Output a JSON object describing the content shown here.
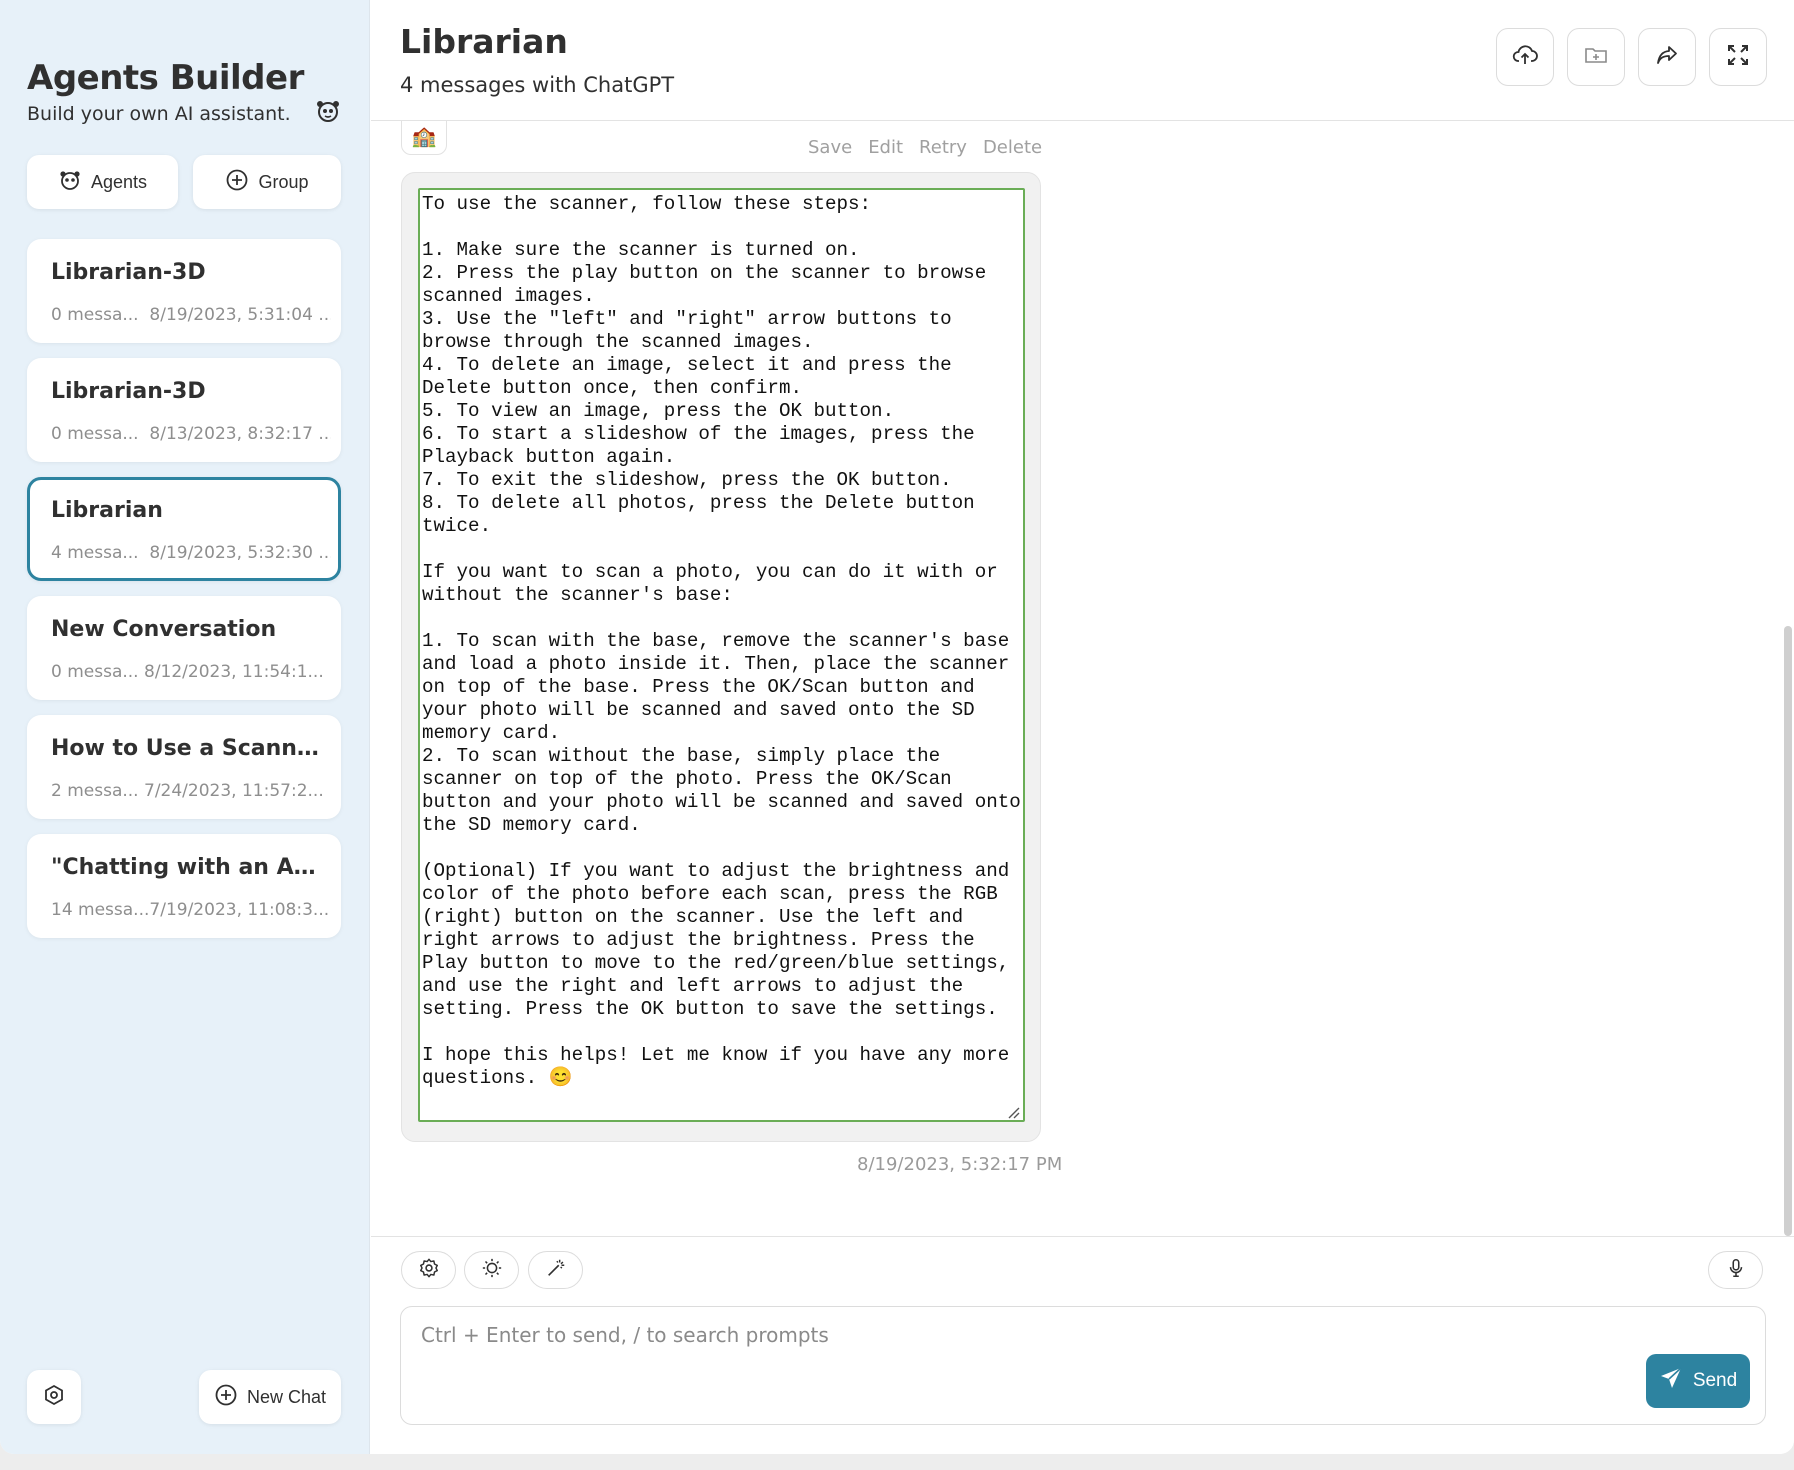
{
  "sidebar": {
    "title": "Agents Builder",
    "subtitle": "Build your own AI assistant.",
    "agents_label": "Agents",
    "group_label": "Group",
    "conversations": [
      {
        "title": "Librarian-3D",
        "count": "0 messa...",
        "date": "8/19/2023, 5:31:04 ..."
      },
      {
        "title": "Librarian-3D",
        "count": "0 messa...",
        "date": "8/13/2023, 8:32:17 ..."
      },
      {
        "title": "Librarian",
        "count": "4 messa...",
        "date": "8/19/2023, 5:32:30 ..."
      },
      {
        "title": "New Conversation",
        "count": "0 messa...",
        "date": "8/12/2023, 11:54:1..."
      },
      {
        "title": "How to Use a Scanner",
        "count": "2 messa...",
        "date": "7/24/2023, 11:57:2..."
      },
      {
        "title": "\"Chatting with an AI ...",
        "count": "14 messa...",
        "date": "7/19/2023, 11:08:3..."
      }
    ],
    "active_index": 2,
    "new_chat_label": "New Chat"
  },
  "header": {
    "title": "Librarian",
    "subtitle": "4 messages with ChatGPT"
  },
  "message": {
    "avatar": "🏫",
    "actions": {
      "save": "Save",
      "edit": "Edit",
      "retry": "Retry",
      "delete": "Delete"
    },
    "content": "To use the scanner, follow these steps:\n\n1. Make sure the scanner is turned on.\n2. Press the play button on the scanner to browse scanned images.\n3. Use the \"left\" and \"right\" arrow buttons to browse through the scanned images.\n4. To delete an image, select it and press the Delete button once, then confirm.\n5. To view an image, press the OK button.\n6. To start a slideshow of the images, press the Playback button again.\n7. To exit the slideshow, press the OK button.\n8. To delete all photos, press the Delete button twice.\n\nIf you want to scan a photo, you can do it with or without the scanner's base:\n\n1. To scan with the base, remove the scanner's base and load a photo inside it. Then, place the scanner on top of the base. Press the OK/Scan button and your photo will be scanned and saved onto the SD memory card.\n2. To scan without the base, simply place the scanner on top of the photo. Press the OK/Scan button and your photo will be scanned and saved onto the SD memory card.\n\n(Optional) If you want to adjust the brightness and color of the photo before each scan, press the RGB (right) button on the scanner. Use the left and right arrows to adjust the brightness. Press the Play button to move to the red/green/blue settings, and use the right and left arrows to adjust the setting. Press the OK button to save the settings.\n\nI hope this helps! Let me know if you have any more questions. 😊",
    "timestamp": "8/19/2023, 5:32:17 PM"
  },
  "composer": {
    "placeholder": "Ctrl + Enter to send, / to search prompts",
    "send_label": "Send"
  },
  "colors": {
    "accent": "#2d83a0",
    "sidebar_bg": "#e7f1f9",
    "editor_border": "#6aad56"
  }
}
